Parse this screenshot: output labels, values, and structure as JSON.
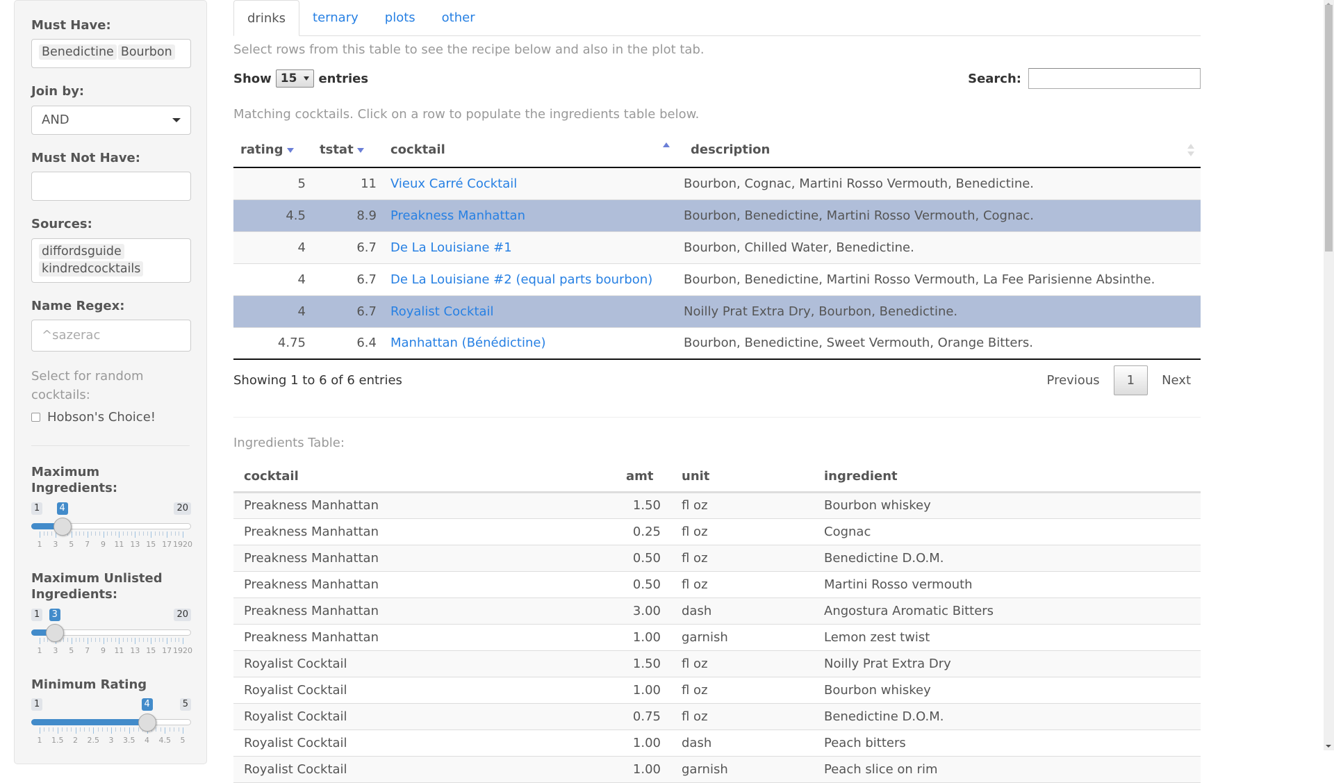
{
  "sidebar": {
    "must_have": {
      "label": "Must Have:",
      "tags": [
        "Benedictine",
        "Bourbon"
      ]
    },
    "join_by": {
      "label": "Join by:",
      "value": "AND"
    },
    "must_not_have": {
      "label": "Must Not Have:",
      "tags": []
    },
    "sources": {
      "label": "Sources:",
      "tags": [
        "diffordsguide",
        "kindredcocktails"
      ]
    },
    "name_regex": {
      "label": "Name Regex:",
      "placeholder": "^sazerac"
    },
    "random_help": "Select for random cocktails:",
    "hobsons_choice": {
      "label": "Hobson's Choice!",
      "checked": false
    },
    "max_ingredients": {
      "label": "Maximum Ingredients:",
      "min": 1,
      "max": 20,
      "value": 4,
      "min_label": "1",
      "max_label": "20",
      "value_label": "4",
      "tick_labels": [
        "1",
        "3",
        "5",
        "7",
        "9",
        "11",
        "13",
        "15",
        "17",
        "1920"
      ]
    },
    "max_unlisted": {
      "label": "Maximum Unlisted Ingredients:",
      "min": 1,
      "max": 20,
      "value": 3,
      "min_label": "1",
      "max_label": "20",
      "value_label": "3",
      "tick_labels": [
        "1",
        "3",
        "5",
        "7",
        "9",
        "11",
        "13",
        "15",
        "17",
        "1920"
      ]
    },
    "min_rating": {
      "label": "Minimum Rating",
      "min": 1,
      "max": 5,
      "value": 4,
      "min_label": "1",
      "max_label": "5",
      "value_label": "4",
      "tick_labels": [
        "1",
        "1.5",
        "2",
        "2.5",
        "3",
        "3.5",
        "4",
        "4.5",
        "5"
      ]
    }
  },
  "tabs": [
    {
      "label": "drinks",
      "active": true
    },
    {
      "label": "ternary",
      "active": false
    },
    {
      "label": "plots",
      "active": false
    },
    {
      "label": "other",
      "active": false
    }
  ],
  "drinks": {
    "note": "Select rows from this table to see the recipe below and also in the plot tab.",
    "show_label": "Show",
    "entries_label": "entries",
    "page_length": "15",
    "search_label": "Search:",
    "search_value": "",
    "caption": "Matching cocktails. Click on a row to populate the ingredients table below.",
    "columns": [
      "rating",
      "tstat",
      "cocktail",
      "description"
    ],
    "rows": [
      {
        "rating": "5",
        "tstat": "11",
        "cocktail": "Vieux Carré Cocktail",
        "description": "Bourbon, Cognac, Martini Rosso Vermouth, Benedictine.",
        "selected": false
      },
      {
        "rating": "4.5",
        "tstat": "8.9",
        "cocktail": "Preakness Manhattan",
        "description": "Bourbon, Benedictine, Martini Rosso Vermouth, Cognac.",
        "selected": true
      },
      {
        "rating": "4",
        "tstat": "6.7",
        "cocktail": "De La Louisiane #1",
        "description": "Bourbon, Chilled Water, Benedictine.",
        "selected": false
      },
      {
        "rating": "4",
        "tstat": "6.7",
        "cocktail": "De La Louisiane #2 (equal parts bourbon)",
        "description": "Bourbon, Benedictine, Martini Rosso Vermouth, La Fee Parisienne Absinthe.",
        "selected": false
      },
      {
        "rating": "4",
        "tstat": "6.7",
        "cocktail": "Royalist Cocktail",
        "description": "Noilly Prat Extra Dry, Bourbon, Benedictine.",
        "selected": true
      },
      {
        "rating": "4.75",
        "tstat": "6.4",
        "cocktail": "Manhattan (Bénédictine)",
        "description": "Bourbon, Benedictine, Sweet Vermouth, Orange Bitters.",
        "selected": false
      }
    ],
    "info": "Showing 1 to 6 of 6 entries",
    "pager": {
      "previous": "Previous",
      "current": "1",
      "next": "Next"
    }
  },
  "ingredients": {
    "caption": "Ingredients Table:",
    "columns": [
      "cocktail",
      "amt",
      "unit",
      "ingredient"
    ],
    "rows": [
      {
        "cocktail": "Preakness Manhattan",
        "amt": "1.50",
        "unit": "fl oz",
        "ingredient": "Bourbon whiskey"
      },
      {
        "cocktail": "Preakness Manhattan",
        "amt": "0.25",
        "unit": "fl oz",
        "ingredient": "Cognac"
      },
      {
        "cocktail": "Preakness Manhattan",
        "amt": "0.50",
        "unit": "fl oz",
        "ingredient": "Benedictine D.O.M."
      },
      {
        "cocktail": "Preakness Manhattan",
        "amt": "0.50",
        "unit": "fl oz",
        "ingredient": "Martini Rosso vermouth"
      },
      {
        "cocktail": "Preakness Manhattan",
        "amt": "3.00",
        "unit": "dash",
        "ingredient": "Angostura Aromatic Bitters"
      },
      {
        "cocktail": "Preakness Manhattan",
        "amt": "1.00",
        "unit": "garnish",
        "ingredient": "Lemon zest twist"
      },
      {
        "cocktail": "Royalist Cocktail",
        "amt": "1.50",
        "unit": "fl oz",
        "ingredient": "Noilly Prat Extra Dry"
      },
      {
        "cocktail": "Royalist Cocktail",
        "amt": "1.00",
        "unit": "fl oz",
        "ingredient": "Bourbon whiskey"
      },
      {
        "cocktail": "Royalist Cocktail",
        "amt": "0.75",
        "unit": "fl oz",
        "ingredient": "Benedictine D.O.M."
      },
      {
        "cocktail": "Royalist Cocktail",
        "amt": "1.00",
        "unit": "dash",
        "ingredient": "Peach bitters"
      },
      {
        "cocktail": "Royalist Cocktail",
        "amt": "1.00",
        "unit": "garnish",
        "ingredient": "Peach slice on rim"
      }
    ]
  },
  "colors": {
    "accent": "#2780e3",
    "selected_row": "#b0bed9",
    "slider": "#428bca"
  }
}
